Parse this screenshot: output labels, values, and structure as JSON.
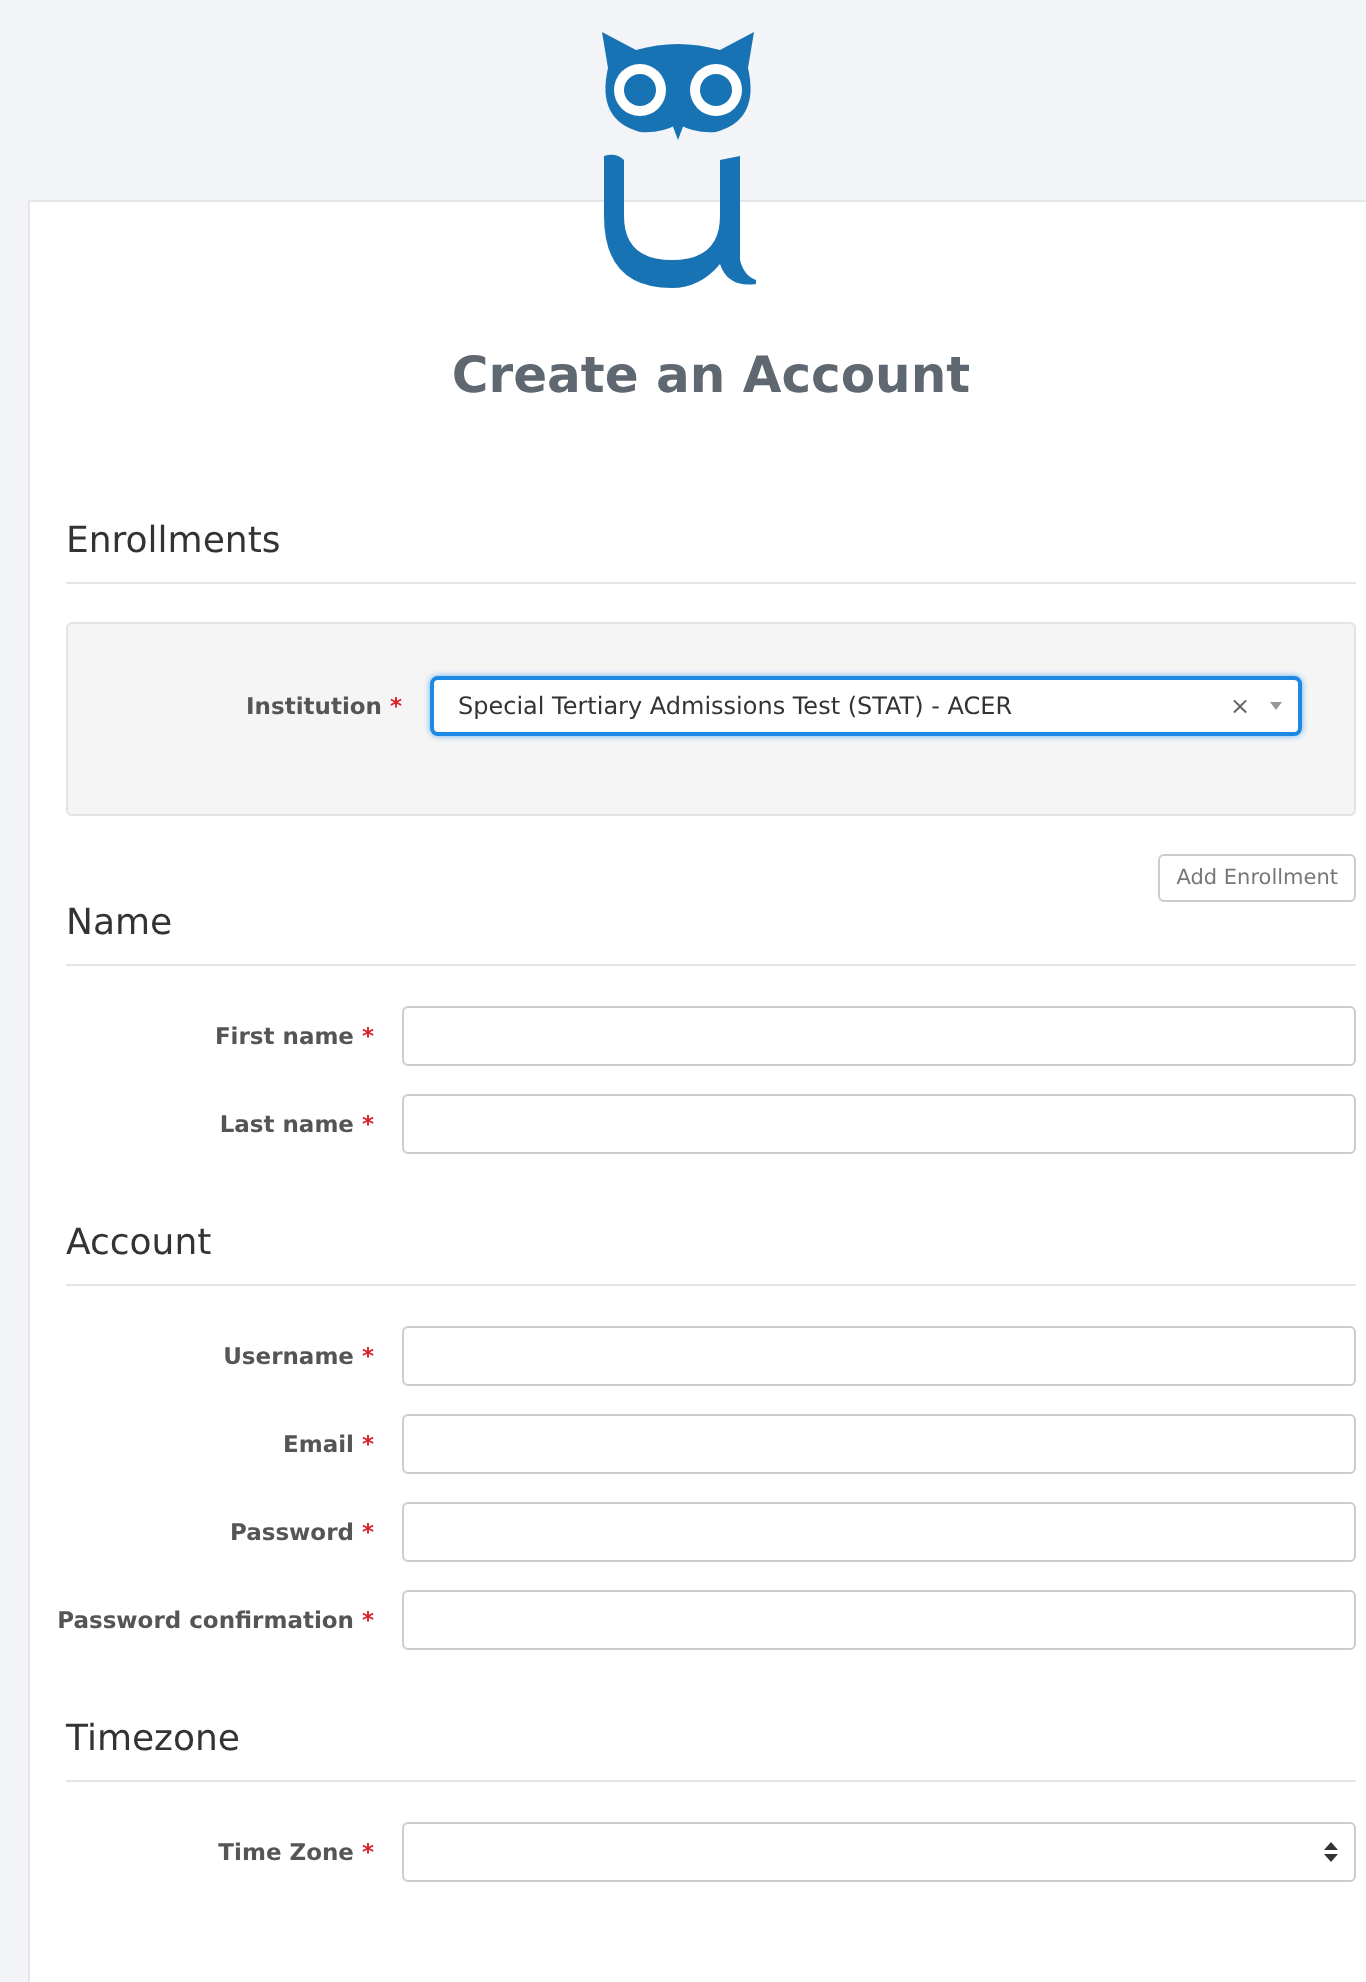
{
  "title": "Create an Account",
  "enrollments": {
    "heading": "Enrollments",
    "institution": {
      "label": "Institution",
      "required_mark": "*",
      "value": "Special Tertiary Admissions Test (STAT) - ACER",
      "clear": "×"
    },
    "add_button": "Add Enrollment"
  },
  "sections": [
    {
      "heading": "Name",
      "fields": [
        {
          "kind": "text",
          "label": "First name",
          "required_mark": "*"
        },
        {
          "kind": "text",
          "label": "Last name",
          "required_mark": "*"
        }
      ]
    },
    {
      "heading": "Account",
      "fields": [
        {
          "kind": "text",
          "label": "Username",
          "required_mark": "*"
        },
        {
          "kind": "text",
          "label": "Email",
          "required_mark": "*"
        },
        {
          "kind": "password",
          "label": "Password",
          "required_mark": "*"
        },
        {
          "kind": "password",
          "label": "Password confirmation",
          "required_mark": "*"
        }
      ]
    },
    {
      "heading": "Timezone",
      "fields": [
        {
          "kind": "select",
          "label": "Time Zone",
          "required_mark": "*"
        }
      ]
    }
  ]
}
